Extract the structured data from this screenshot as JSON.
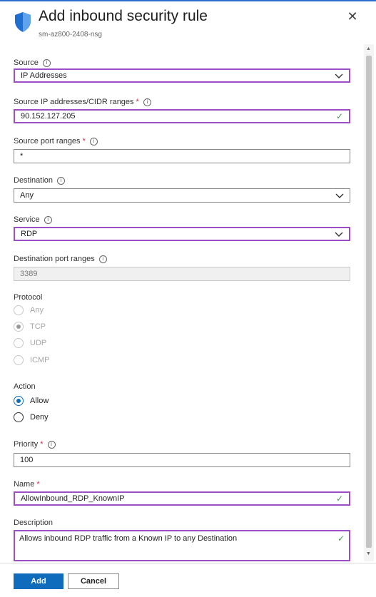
{
  "header": {
    "title": "Add inbound security rule",
    "subtitle": "sm-az800-2408-nsg",
    "close_glyph": "✕"
  },
  "form": {
    "source": {
      "label": "Source",
      "value": "IP Addresses"
    },
    "source_ip": {
      "label": "Source IP addresses/CIDR ranges",
      "required": "*",
      "value": "90.152.127.205"
    },
    "source_port": {
      "label": "Source port ranges",
      "required": "*",
      "value": "*"
    },
    "destination": {
      "label": "Destination",
      "value": "Any"
    },
    "service": {
      "label": "Service",
      "value": "RDP"
    },
    "dest_port": {
      "label": "Destination port ranges",
      "value": "3389"
    },
    "protocol": {
      "label": "Protocol",
      "options": [
        "Any",
        "TCP",
        "UDP",
        "ICMP"
      ],
      "selected": "TCP"
    },
    "action": {
      "label": "Action",
      "options": [
        "Allow",
        "Deny"
      ],
      "selected": "Allow"
    },
    "priority": {
      "label": "Priority",
      "required": "*",
      "value": "100"
    },
    "name": {
      "label": "Name",
      "required": "*",
      "value": "AllowInbound_RDP_KnownIP"
    },
    "description": {
      "label": "Description",
      "value": "Allows inbound RDP traffic from a Known IP to any Destination"
    }
  },
  "footer": {
    "add_label": "Add",
    "cancel_label": "Cancel"
  },
  "icons": {
    "info": "i",
    "check": "✓",
    "scroll_up": "▲",
    "scroll_down": "▼"
  },
  "colors": {
    "accent": "#0f6cbd",
    "focus_border": "#9c4fc4",
    "valid": "#3ca24a",
    "required": "#c4314b"
  }
}
